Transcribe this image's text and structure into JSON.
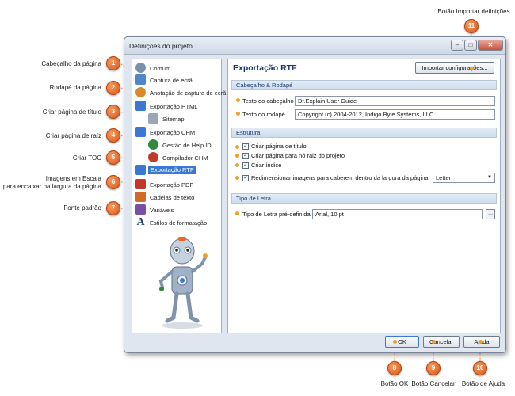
{
  "window": {
    "title": "Definições do projeto",
    "min_glyph": "–",
    "max_glyph": "□",
    "close_glyph": "✕"
  },
  "nav": {
    "items": [
      {
        "label": "Comum",
        "icon": "gear-globe-icon",
        "color": "#7a8fa8"
      },
      {
        "label": "Captura de ecrã",
        "icon": "screenshot-icon",
        "color": "#4f87c8"
      },
      {
        "label": "Anotação de captura de ecrã",
        "icon": "annotation-icon",
        "color": "#d98a2a"
      },
      {
        "label": "Exportação HTML",
        "icon": "html-export-icon",
        "color": "#3a78d4"
      },
      {
        "label": "Sitemap",
        "icon": "sitemap-icon",
        "color": "#9aa6b4"
      },
      {
        "label": "Exportação CHM",
        "icon": "chm-export-icon",
        "color": "#3a78d4"
      },
      {
        "label": "Gestão de Help ID",
        "icon": "help-id-icon",
        "color": "#2f8a3c"
      },
      {
        "label": "Compilador CHM",
        "icon": "compiler-icon",
        "color": "#c0392b"
      },
      {
        "label": "Exportação RTF",
        "icon": "rtf-export-icon",
        "color": "#3a78d4"
      },
      {
        "label": "Exportação PDF",
        "icon": "pdf-export-icon",
        "color": "#c0392b"
      },
      {
        "label": "Cadeias de texto",
        "icon": "text-strings-icon",
        "color": "#d06a2a"
      },
      {
        "label": "Variáveis",
        "icon": "variables-icon",
        "color": "#7a4fa8"
      },
      {
        "label": "Estilos de formatação",
        "icon": "font-styles-icon",
        "color": "#1e3b70"
      }
    ],
    "selected_index": 8
  },
  "content": {
    "page_title": "Exportação RTF",
    "import_button": "Importar configurações...",
    "header_footer_section": "Cabeçalho & Rodapé",
    "header_label": "Texto do cabeçalho",
    "header_value": "Dr.Explain User Guide",
    "footer_label": "Texto do rodapé",
    "footer_value": "Copyright (c) 2004-2012, Indigo Byte Systems, LLC",
    "structure_section": "Estrutura",
    "checkboxes": [
      {
        "label": "Criar página de título",
        "checked": true
      },
      {
        "label": "Criar página para nó raiz do projeto",
        "checked": true
      },
      {
        "label": "Criar índice",
        "checked": true
      },
      {
        "label": "Redimensionar imagens para caberem dentro da largura da página",
        "checked": true
      }
    ],
    "check_glyph": "✓",
    "page_size_value": "Letter",
    "dropdown_glyph": "▼",
    "font_section": "Tipo de Letra",
    "font_label": "Tipo de Letra pré-definida",
    "font_value": "Arial, 10 pt",
    "browse_label": "..."
  },
  "buttons": {
    "ok": "OK",
    "cancel": "Cancelar",
    "help": "Ajuda"
  },
  "callouts": [
    {
      "number": "1",
      "label": "Cabeçalho da página"
    },
    {
      "number": "2",
      "label": "Rodapé da página"
    },
    {
      "number": "3",
      "label": "Criar página de título"
    },
    {
      "number": "4",
      "label": "Criar página de raíz"
    },
    {
      "number": "5",
      "label": "Criar TOC"
    },
    {
      "number": "6",
      "label_line1": "Imagens em Escala",
      "label_line2": "para encaixar na largura da página"
    },
    {
      "number": "7",
      "label": "Fonte padrão"
    },
    {
      "number": "8",
      "label": "Botão OK"
    },
    {
      "number": "9",
      "label": "Botão Cancelar"
    },
    {
      "number": "10",
      "label": "Botão de Ajuda"
    },
    {
      "number": "11",
      "label": "Botão Importar definições"
    }
  ],
  "colors": {
    "accent": "#3a78d4",
    "marker": "#e8692a",
    "leader": "#e8692a",
    "dot": "#f4a020"
  }
}
